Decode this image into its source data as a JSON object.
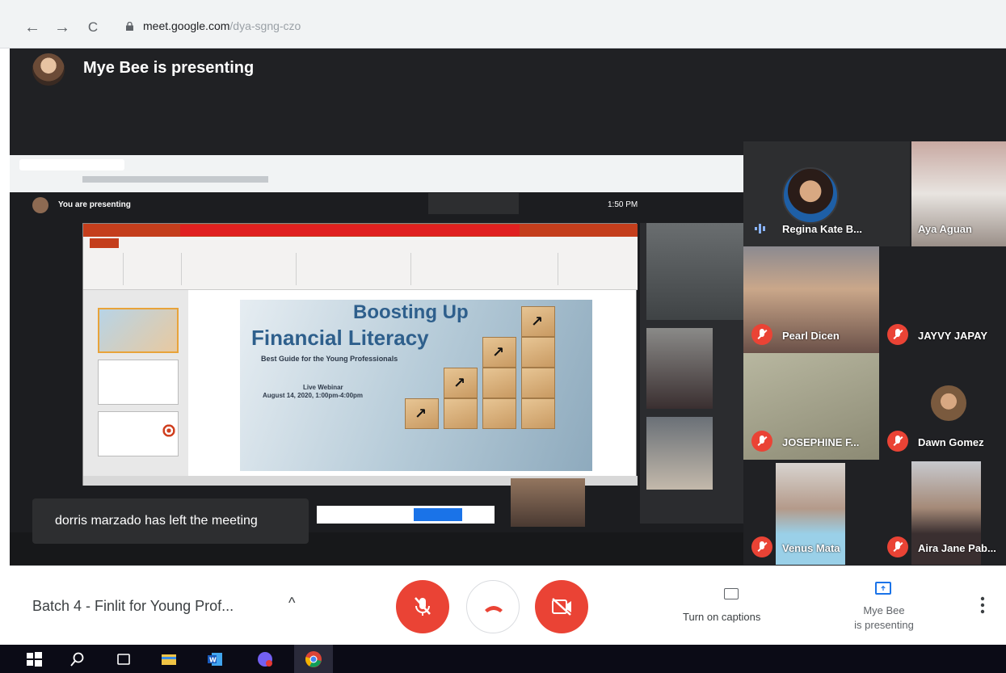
{
  "browser": {
    "back": "←",
    "forward": "→",
    "reload": "C",
    "url_host": "meet.google.com",
    "url_path": "/dya-sgng-czo"
  },
  "presenter_banner": {
    "text": "Mye Bee is presenting"
  },
  "shared_screen": {
    "inner_presenting": "You are presenting",
    "inner_clock": "1:50 PM",
    "slide": {
      "title_line1": "Boosting Up",
      "title_line2": "Financial Literacy",
      "subtitle": "Best Guide for the Young Professionals",
      "event": "Live Webinar",
      "date": "August 14, 2020, 1:00pm-4:00pm"
    }
  },
  "toast": {
    "text": "dorris marzado has left the meeting"
  },
  "participants": [
    {
      "name": "Regina Kate B...",
      "status": "speaking"
    },
    {
      "name": "Aya Aguan",
      "status": "muted"
    },
    {
      "name": "Pearl Dicen",
      "status": "muted"
    },
    {
      "name": "JAYVY JAPAY",
      "status": "muted"
    },
    {
      "name": "JOSEPHINE F...",
      "status": "muted"
    },
    {
      "name": "Dawn Gomez",
      "status": "muted"
    },
    {
      "name": "Venus Mata",
      "status": "muted"
    },
    {
      "name": "Aira Jane Pab...",
      "status": "muted"
    }
  ],
  "bottom_bar": {
    "meeting_title": "Batch 4 - Finlit for Young Prof...",
    "caret": "^",
    "captions_label": "Turn on captions",
    "present_label_line1": "Mye Bee",
    "present_label_line2": "is presenting"
  },
  "colors": {
    "meet_bg": "#202124",
    "mute_red": "#ea4335",
    "accent_blue": "#1a73e8",
    "slide_title": "#2e5f8c"
  },
  "icons": [
    "back-arrow-icon",
    "forward-arrow-icon",
    "reload-icon",
    "lock-icon",
    "mic-off-icon",
    "hang-up-icon",
    "camera-off-icon",
    "captions-icon",
    "present-icon",
    "more-vert-icon",
    "windows-start-icon",
    "search-icon",
    "task-view-icon",
    "file-explorer-icon",
    "word-icon",
    "viber-icon",
    "chrome-icon"
  ]
}
